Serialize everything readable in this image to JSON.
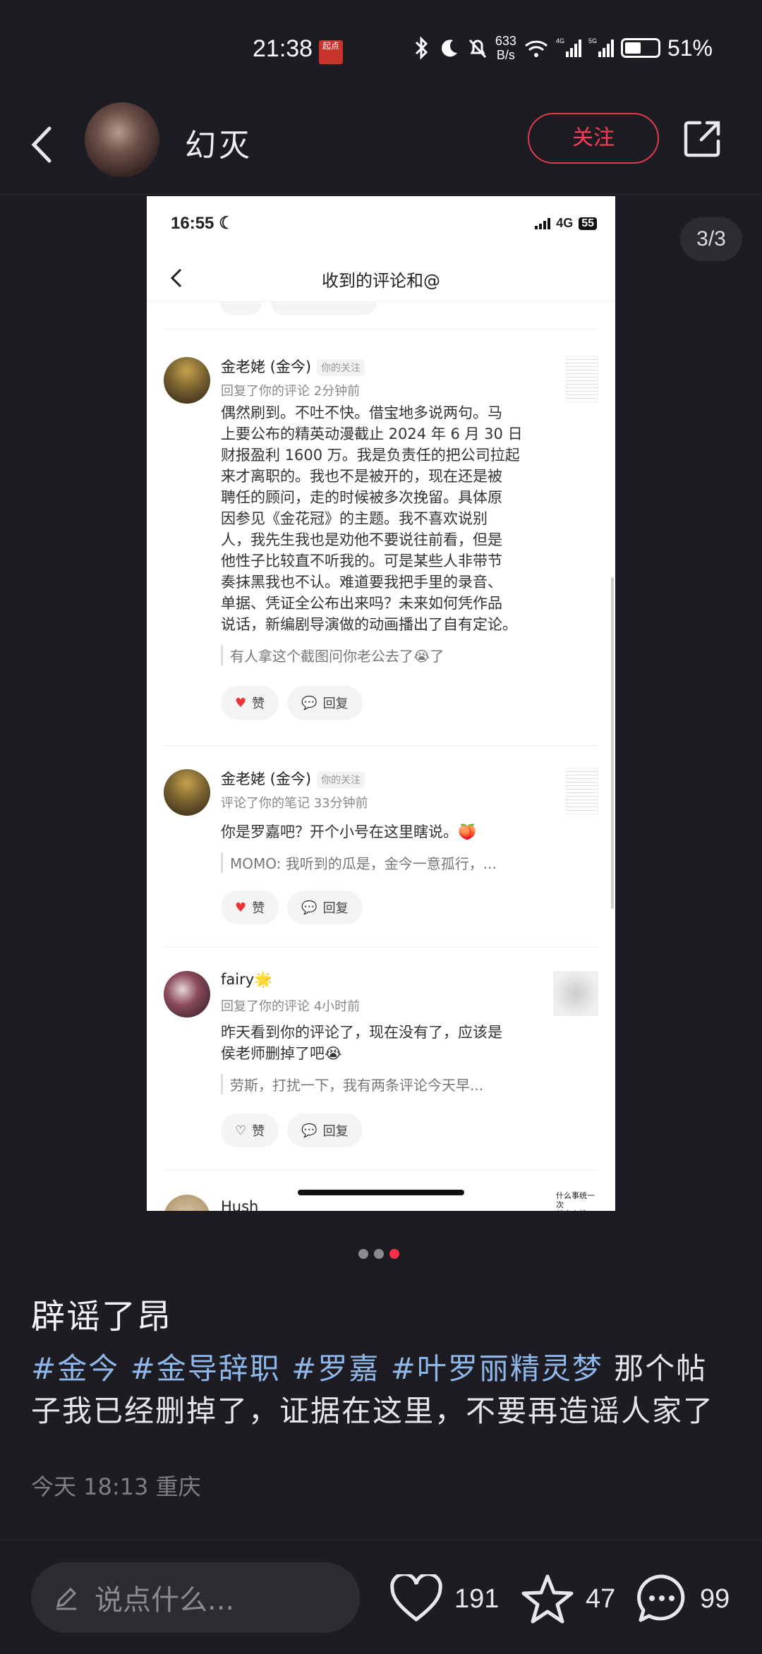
{
  "status_bar": {
    "time": "21:38",
    "app_badge": "起点",
    "net_speed_value": "633",
    "net_speed_unit": "B/s",
    "battery_percent": "51%",
    "battery_level": 0.51
  },
  "header": {
    "username": "幻灭",
    "follow_label": "关注"
  },
  "gallery": {
    "counter": "3/3",
    "pages": 3,
    "active_page": 3
  },
  "screenshot": {
    "status_time": "16:55",
    "network": "4G",
    "battery": "55",
    "nav_title": "收到的评论和@",
    "comments": [
      {
        "name": "金老姥 (金今)",
        "tag": "你的关注",
        "meta": "回复了你的评论  2分钟前",
        "body": "偶然刷到。不吐不快。借宝地多说两句。马\n上要公布的精英动漫截止 2024 年 6 月 30 日\n财报盈利 1600 万。我是负责任的把公司拉起\n来才离职的。我也不是被开的，现在还是被\n聘任的顾问，走的时候被多次挽留。具体原\n因参见《金花冠》的主题。我不喜欢说别\n人，我先生我也是劝他不要说往前看，但是\n他性子比较直不听我的。可是某些人非带节\n奏抹黑我也不认。难道要我把手里的录音、\n单据、凭证全公布出来吗？未来如何凭作品\n说话，新编剧导演做的动画播出了自有定论。",
        "quote": "有人拿这个截图问你老公去了😭了",
        "like_label": "赞",
        "reply_label": "回复"
      },
      {
        "name": "金老姥 (金今)",
        "tag": "你的关注",
        "meta": "评论了你的笔记  33分钟前",
        "body": "你是罗嘉吧？开个小号在这里瞎说。🍑",
        "quote": "MOMO: 我听到的瓜是，金今一意孤行，...",
        "like_label": "赞",
        "reply_label": "回复"
      },
      {
        "name": "fairy🌟",
        "meta": "回复了你的评论  4小时前",
        "body": "昨天看到你的评论了，现在没有了，应该是\n侯老师删掉了吧😭",
        "quote": "劳斯，打扰一下，我有两条评论今天早...",
        "like_label": "赞",
        "reply_label": "回复"
      }
    ],
    "next_name": "Hush",
    "next_thumb_text": "什么事统一次\n就会上榜?"
  },
  "post": {
    "title": "辟谣了昂",
    "hashtags": [
      "#金今",
      "#金导辞职",
      "#罗嘉",
      "#叶罗丽精灵梦"
    ],
    "body_text": "那个帖子我已经删掉了，证据在这里，不要再造谣人家了",
    "meta": "今天 18:13 重庆"
  },
  "bottom_bar": {
    "input_placeholder": "说点什么...",
    "likes": "191",
    "favorites": "47",
    "comments": "99"
  },
  "colors": {
    "background": "#1c1c22",
    "accent_red": "#ff2d46",
    "hashtag_blue": "#8fb6e8"
  }
}
